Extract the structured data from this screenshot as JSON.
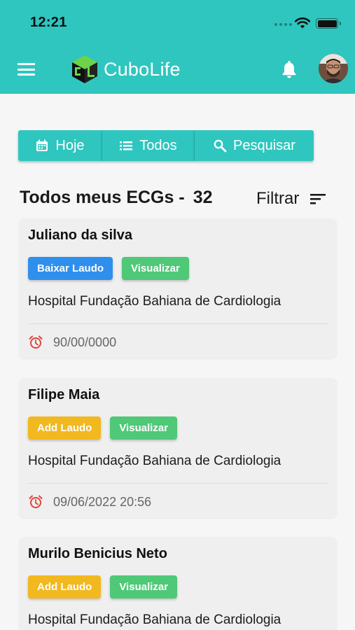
{
  "status_bar": {
    "time": "12:21"
  },
  "app": {
    "brand": "CuboLife"
  },
  "colors": {
    "primary": "#2fc6bf",
    "blue": "#2f8fec",
    "green": "#4fc877",
    "yellow": "#f2b81f",
    "alarm": "#e0443c"
  },
  "icons": {
    "menu": "hamburger-menu-icon",
    "bell": "bell-icon",
    "calendar": "calendar-icon",
    "list": "list-icon",
    "search": "search-icon",
    "sort": "sort-icon",
    "alarm": "alarm-clock-icon"
  },
  "filters": [
    {
      "label": "Hoje"
    },
    {
      "label": "Todos"
    },
    {
      "label": "Pesquisar"
    }
  ],
  "list": {
    "title": "Todos meus ECGs -",
    "count": "32",
    "filter_label": "Filtrar"
  },
  "ecgs": [
    {
      "name": "Juliano da silva",
      "primary_action": "Baixar Laudo",
      "secondary_action": "Visualizar",
      "hospital": "Hospital Fundação Bahiana de Cardiologia",
      "date": "90/00/0000"
    },
    {
      "name": "Filipe Maia",
      "primary_action": "Add Laudo",
      "secondary_action": "Visualizar",
      "hospital": "Hospital Fundação Bahiana de Cardiologia",
      "date": "09/06/2022 20:56"
    },
    {
      "name": "Murilo Benicius Neto",
      "primary_action": "Add Laudo",
      "secondary_action": "Visualizar",
      "hospital": "Hospital Fundação Bahiana de Cardiologia",
      "date": ""
    }
  ]
}
